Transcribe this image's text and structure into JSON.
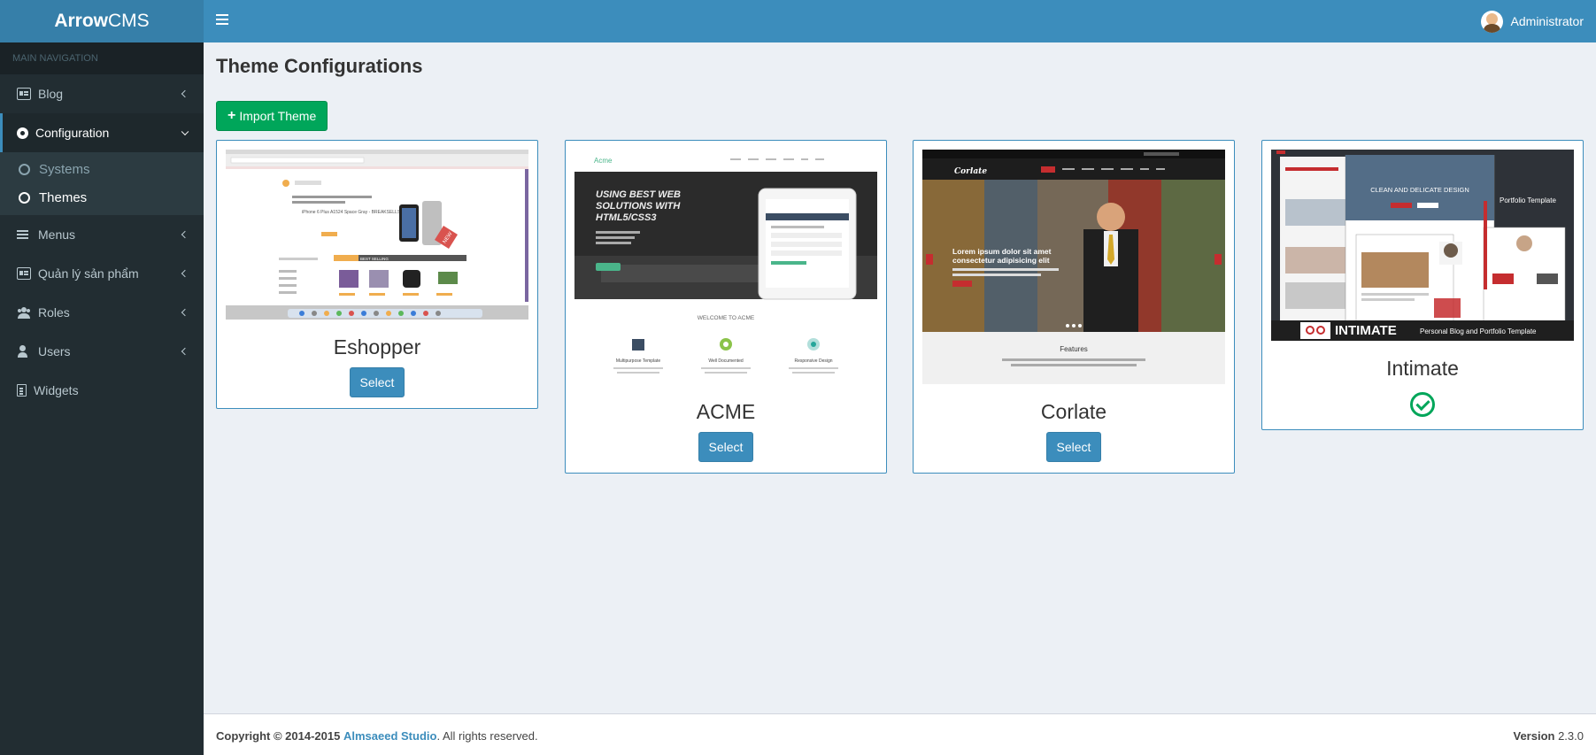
{
  "app": {
    "logo_bold": "Arrow",
    "logo_rest": "CMS"
  },
  "header": {
    "user_name": "Administrator"
  },
  "sidebar": {
    "header": "MAIN NAVIGATION",
    "items": [
      {
        "label": "Blog",
        "icon": "newspaper-icon"
      },
      {
        "label": "Configuration",
        "icon": "gear-icon",
        "active": true,
        "children": [
          {
            "label": "Systems"
          },
          {
            "label": "Themes",
            "current": true
          }
        ]
      },
      {
        "label": "Menus",
        "icon": "bars-icon"
      },
      {
        "label": "Quản lý sản phẩm",
        "icon": "newspaper-icon"
      },
      {
        "label": "Roles",
        "icon": "users-icon"
      },
      {
        "label": "Users",
        "icon": "user-icon"
      },
      {
        "label": "Widgets",
        "icon": "file-icon"
      }
    ]
  },
  "main": {
    "title": "Theme Configurations",
    "import_button": "Import Theme",
    "themes": [
      {
        "name": "Eshopper",
        "action": "Select",
        "active": false,
        "preview": {
          "product_title": "iPhone 6 Plus A1524 Space Gray - BREAKSELLS",
          "badge": "NEW",
          "tab": "BEST SELLING"
        }
      },
      {
        "name": "ACME",
        "action": "Select",
        "active": false,
        "preview": {
          "brand": "Acme",
          "headline_1": "USING BEST WEB",
          "headline_2": "SOLUTIONS WITH",
          "headline_3": "HTML5/CSS3",
          "welcome": "WELCOME TO ACME",
          "features": [
            "Multipurpose Template",
            "Well Documented",
            "Responsive Design"
          ]
        }
      },
      {
        "name": "Corlate",
        "action": "Select",
        "active": false,
        "preview": {
          "brand": "Corlate",
          "headline_1": "Lorem ipsum dolor sit amet",
          "headline_2": "consectetur adipisicing elit",
          "section": "Features"
        }
      },
      {
        "name": "Intimate",
        "action": null,
        "active": true,
        "preview": {
          "headline": "CLEAN AND DELICATE DESIGN",
          "side": "Portfolio Template",
          "brand": "INTIMATE",
          "tagline": "Personal Blog and Portfolio Template"
        }
      }
    ]
  },
  "footer": {
    "copyright": "Copyright © 2014-2015",
    "company": "Almsaeed Studio",
    "rights": ". All rights reserved.",
    "version_label": "Version",
    "version": "2.3.0"
  },
  "colors": {
    "primary": "#3c8dbc",
    "success": "#00a65a",
    "sidebar": "#222d32"
  }
}
